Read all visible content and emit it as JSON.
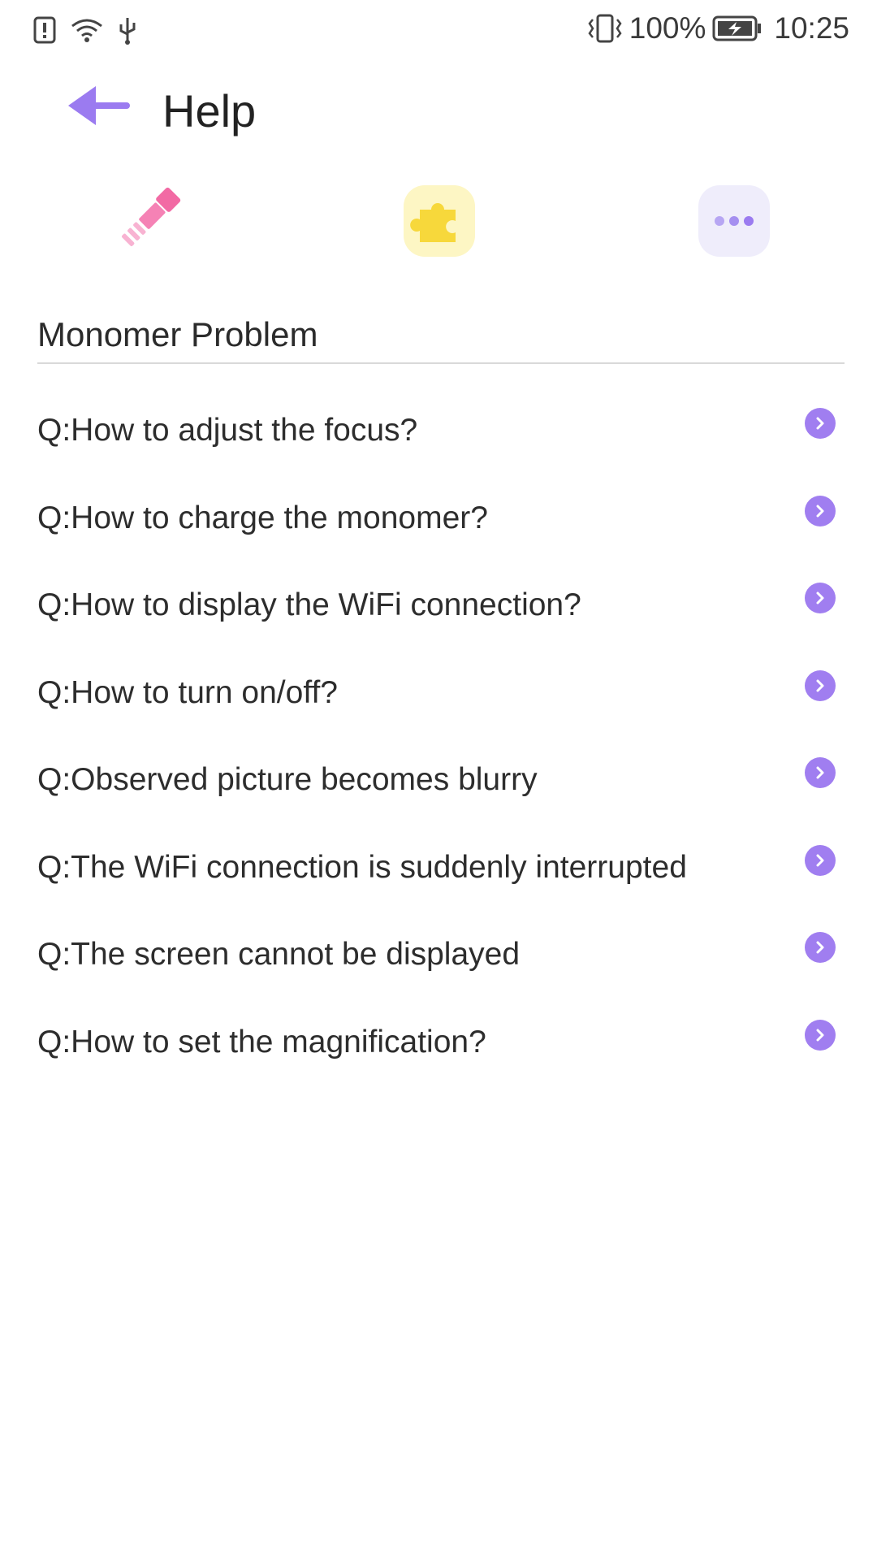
{
  "status_bar": {
    "battery_percent": "100%",
    "time": "10:25",
    "icons": [
      "alert-card-icon",
      "wifi-icon",
      "usb-icon",
      "vibrate-icon",
      "battery-charging-icon"
    ]
  },
  "header": {
    "title": "Help",
    "back_icon": "arrow-left-icon"
  },
  "categories": [
    {
      "icon": "flashlight-icon",
      "color": "#f26aa4"
    },
    {
      "icon": "puzzle-icon",
      "color": "#f7d83b"
    },
    {
      "icon": "more-dots-icon",
      "color": "#a58ff0"
    }
  ],
  "section": {
    "title": "Monomer Problem"
  },
  "faq": [
    {
      "question": "Q:How to adjust the focus?"
    },
    {
      "question": "Q:How to charge the monomer?"
    },
    {
      "question": "Q:How to display the WiFi connection?"
    },
    {
      "question": "Q:How to turn on/off?"
    },
    {
      "question": "Q:Observed picture becomes blurry"
    },
    {
      "question": "Q:The WiFi connection is suddenly interrupted"
    },
    {
      "question": "Q:The screen cannot be displayed"
    },
    {
      "question": "Q:How to set the magnification?"
    }
  ],
  "colors": {
    "accent": "#9b7bf0",
    "arrow_circle": "#a07ef0"
  }
}
